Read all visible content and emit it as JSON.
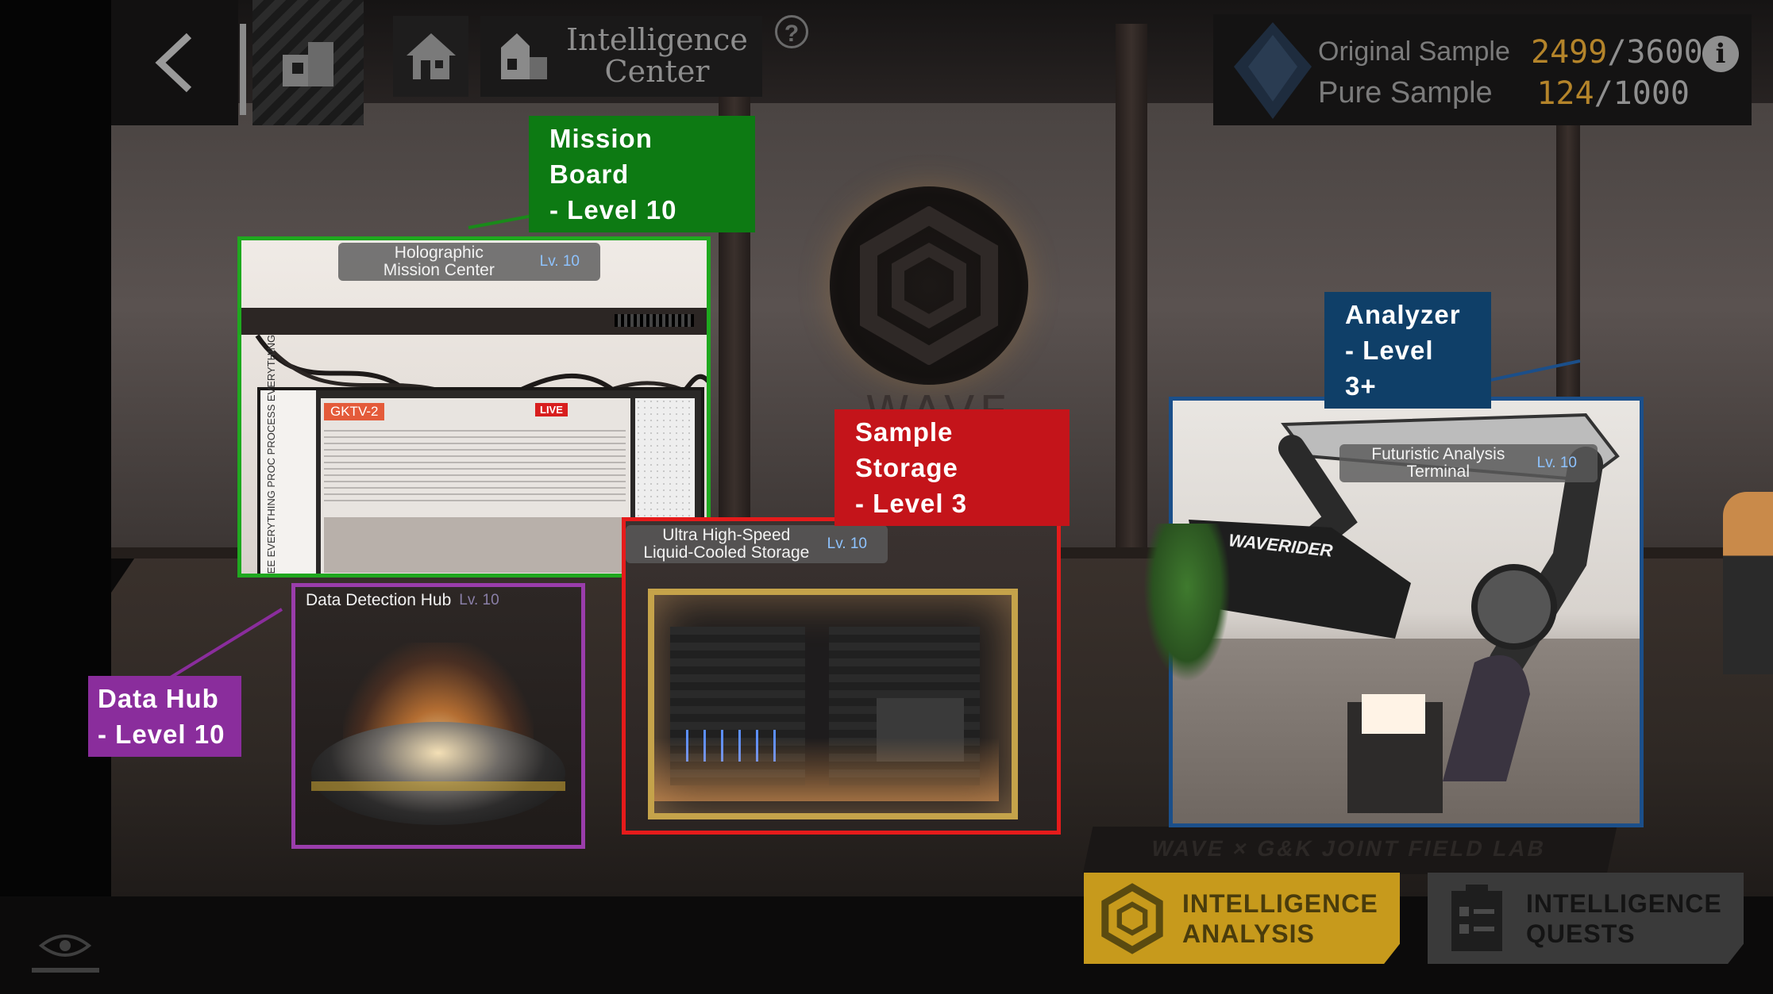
{
  "header": {
    "title_line1": "Intelligence",
    "title_line2": "Center",
    "help": "?"
  },
  "resources": {
    "original_label": "Original Sample",
    "original_current": "2499",
    "original_max": "/3600",
    "pure_label": "Pure Sample",
    "pure_current": "124",
    "pure_max": "/1000",
    "info": "i"
  },
  "scene": {
    "brand_text": "WAVE",
    "floor_text": "WAVE × G&K JOINT FIELD LAB"
  },
  "facilities": {
    "mission": {
      "name_line1": "Holographic",
      "name_line2": "Mission Center",
      "level": "Lv. 10",
      "frame_color": "#1fa81f",
      "screen_tag": "GKTV-2",
      "live_tag": "LIVE",
      "side_text": "SEE EVERYTHING PROC PROCESS EVERYTHING"
    },
    "analyzer": {
      "name_line1": "Futuristic Analysis",
      "name_line2": "Terminal",
      "level": "Lv. 10",
      "frame_color": "#1b4f8a",
      "brand": "WAVERIDER"
    },
    "storage": {
      "name_line1": "Ultra High-Speed",
      "name_line2": "Liquid-Cooled Storage",
      "level": "Lv. 10",
      "frame_color": "#e51b1b"
    },
    "datahub": {
      "name": "Data Detection Hub",
      "level": "Lv. 10",
      "frame_color": "#9a3dab"
    }
  },
  "annotations": {
    "mission": {
      "line1": "Mission Board",
      "line2": "- Level 10",
      "color": "#0d7a13"
    },
    "analyzer": {
      "line1": "Analyzer",
      "line2": "- Level 3+",
      "color": "#0f3f68"
    },
    "storage": {
      "line1": "Sample Storage",
      "line2": "- Level 3",
      "color": "#c4141a"
    },
    "datahub": {
      "line1": "Data Hub",
      "line2": "- Level 10",
      "color": "#8a2d9c"
    }
  },
  "buttons": {
    "analysis": {
      "line1": "INTELLIGENCE",
      "line2": "ANALYSIS",
      "color": "#c79a1c"
    },
    "quests": {
      "line1": "INTELLIGENCE",
      "line2": "QUESTS",
      "color": "#3a3a3a"
    }
  },
  "icons": [
    "back-arrow-icon",
    "dormitory-icon",
    "home-icon",
    "intelligence-center-icon",
    "help-icon",
    "sample-crystal-icon",
    "info-icon",
    "hexagon-icon",
    "clipboard-icon",
    "eye-icon"
  ]
}
